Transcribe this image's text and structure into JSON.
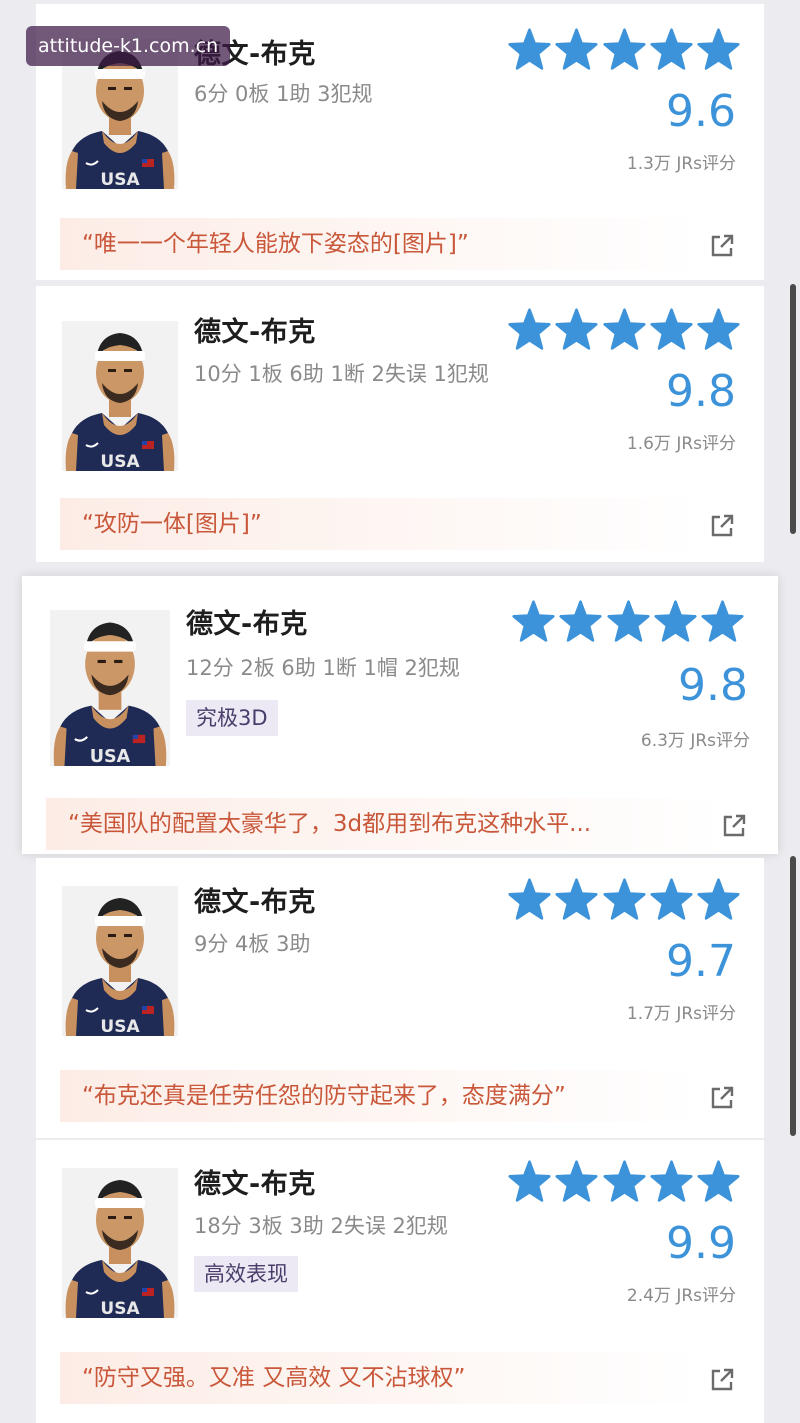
{
  "watermark": "attitude-k1.com.cn",
  "colors": {
    "star": "#3d93d9",
    "score": "#3d93d9",
    "quote_text": "#c9573a",
    "tag_bg": "#ece9f4"
  },
  "icons": {
    "rating": "star-icon",
    "share": "share-external-icon",
    "avatar": "player-avatar"
  },
  "cards": [
    {
      "name": "德文-布克",
      "stats": "6分 0板 1助 3犯规",
      "tag": "",
      "stars": 5,
      "score": "9.6",
      "count": "1.3万 JRs评分",
      "quote": "“唯一一个年轻人能放下姿态的[图片]”"
    },
    {
      "name": "德文-布克",
      "stats": "10分 1板 6助 1断 2失误 1犯规",
      "tag": "",
      "stars": 5,
      "score": "9.8",
      "count": "1.6万 JRs评分",
      "quote": "“攻防一体[图片]”"
    },
    {
      "name": "德文-布克",
      "stats": "12分 2板 6助 1断 1帽 2犯规",
      "tag": "究极3D",
      "stars": 5,
      "score": "9.8",
      "count": "6.3万 JRs评分",
      "quote": "“美国队的配置太豪华了，3d都用到布克这种水平..."
    },
    {
      "name": "德文-布克",
      "stats": "9分 4板 3助",
      "tag": "",
      "stars": 5,
      "score": "9.7",
      "count": "1.7万 JRs评分",
      "quote": "“布克还真是任劳任怨的防守起来了，态度满分”"
    },
    {
      "name": "德文-布克",
      "stats": "18分 3板 3助 2失误 2犯规",
      "tag": "高效表现",
      "stars": 5,
      "score": "9.9",
      "count": "2.4万 JRs评分",
      "quote": "“防守又强。又准 又高效 又不沾球权”"
    }
  ]
}
